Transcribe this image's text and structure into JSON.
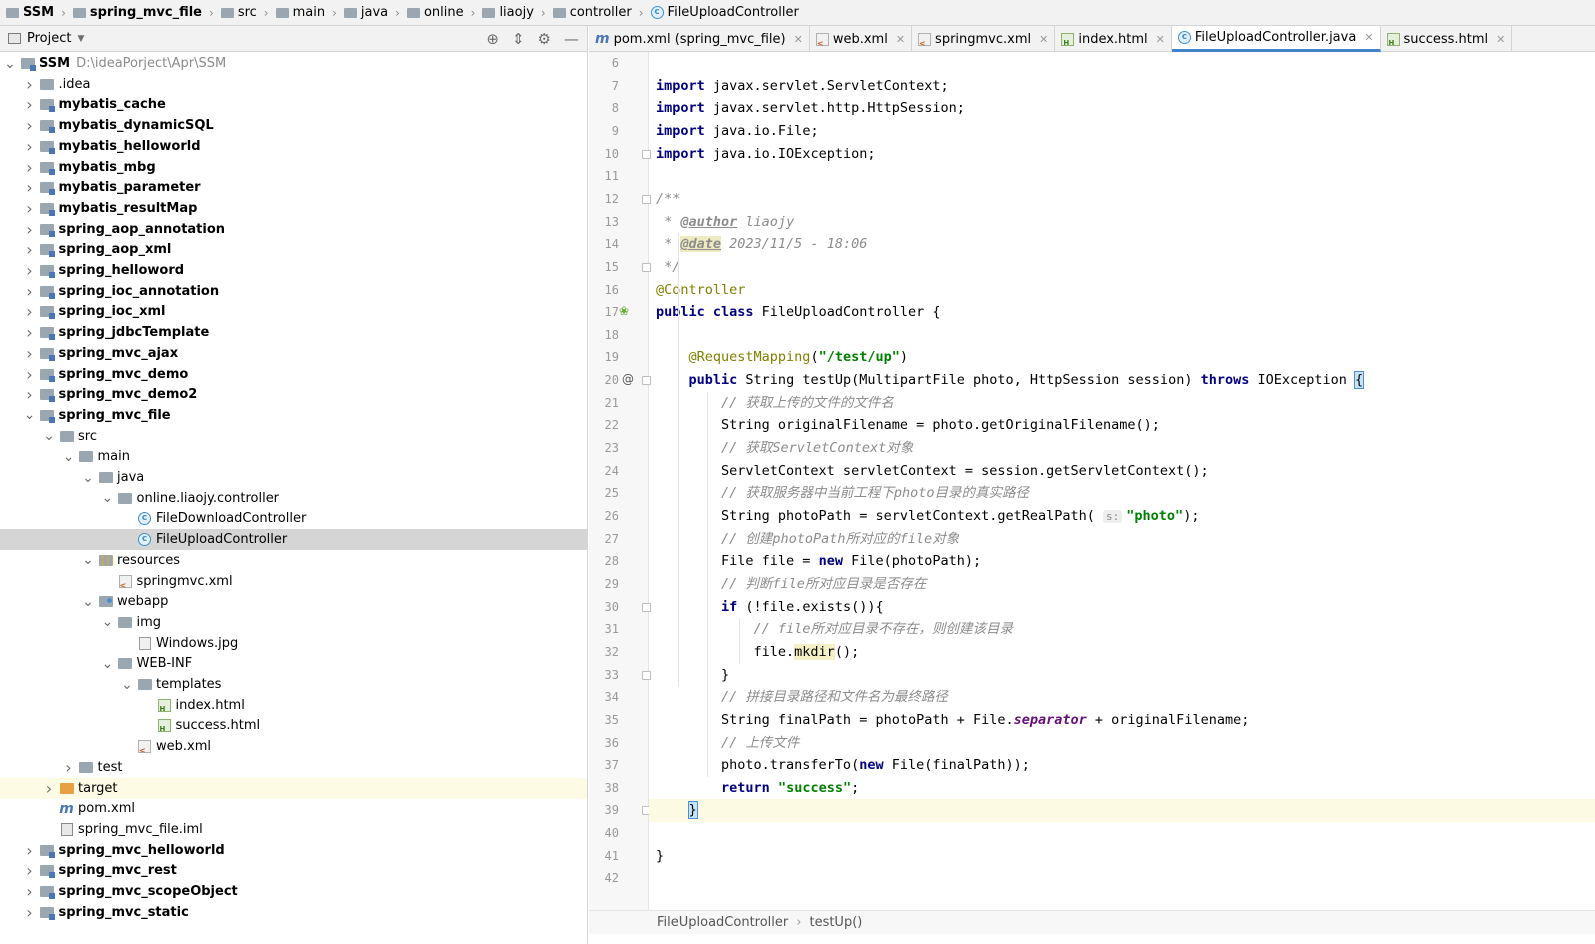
{
  "breadcrumb": {
    "items": [
      {
        "label": "SSM",
        "bold": true
      },
      {
        "label": "spring_mvc_file",
        "bold": true
      },
      {
        "label": "src"
      },
      {
        "label": "main"
      },
      {
        "label": "java"
      },
      {
        "label": "online"
      },
      {
        "label": "liaojy"
      },
      {
        "label": "controller"
      },
      {
        "label": "FileUploadController"
      }
    ]
  },
  "project_panel": {
    "title": "Project",
    "tree": [
      {
        "label": "SSM",
        "path": "D:\\ideaPorject\\Apr\\SSM",
        "depth": 0,
        "expanded": true,
        "icon": "module",
        "bold": true
      },
      {
        "label": ".idea",
        "depth": 1,
        "expanded": false,
        "icon": "folder"
      },
      {
        "label": "mybatis_cache",
        "depth": 1,
        "expanded": false,
        "icon": "module",
        "bold": true
      },
      {
        "label": "mybatis_dynamicSQL",
        "depth": 1,
        "expanded": false,
        "icon": "module",
        "bold": true
      },
      {
        "label": "mybatis_helloworld",
        "depth": 1,
        "expanded": false,
        "icon": "module",
        "bold": true
      },
      {
        "label": "mybatis_mbg",
        "depth": 1,
        "expanded": false,
        "icon": "module",
        "bold": true
      },
      {
        "label": "mybatis_parameter",
        "depth": 1,
        "expanded": false,
        "icon": "module",
        "bold": true
      },
      {
        "label": "mybatis_resultMap",
        "depth": 1,
        "expanded": false,
        "icon": "module",
        "bold": true
      },
      {
        "label": "spring_aop_annotation",
        "depth": 1,
        "expanded": false,
        "icon": "module",
        "bold": true
      },
      {
        "label": "spring_aop_xml",
        "depth": 1,
        "expanded": false,
        "icon": "module",
        "bold": true
      },
      {
        "label": "spring_helloword",
        "depth": 1,
        "expanded": false,
        "icon": "module",
        "bold": true
      },
      {
        "label": "spring_ioc_annotation",
        "depth": 1,
        "expanded": false,
        "icon": "module",
        "bold": true
      },
      {
        "label": "spring_ioc_xml",
        "depth": 1,
        "expanded": false,
        "icon": "module",
        "bold": true
      },
      {
        "label": "spring_jdbcTemplate",
        "depth": 1,
        "expanded": false,
        "icon": "module",
        "bold": true
      },
      {
        "label": "spring_mvc_ajax",
        "depth": 1,
        "expanded": false,
        "icon": "module",
        "bold": true
      },
      {
        "label": "spring_mvc_demo",
        "depth": 1,
        "expanded": false,
        "icon": "module",
        "bold": true
      },
      {
        "label": "spring_mvc_demo2",
        "depth": 1,
        "expanded": false,
        "icon": "module",
        "bold": true
      },
      {
        "label": "spring_mvc_file",
        "depth": 1,
        "expanded": true,
        "icon": "module",
        "bold": true
      },
      {
        "label": "src",
        "depth": 2,
        "expanded": true,
        "icon": "folder"
      },
      {
        "label": "main",
        "depth": 3,
        "expanded": true,
        "icon": "folder"
      },
      {
        "label": "java",
        "depth": 4,
        "expanded": true,
        "icon": "folder-source"
      },
      {
        "label": "online.liaojy.controller",
        "depth": 5,
        "expanded": true,
        "icon": "folder"
      },
      {
        "label": "FileDownloadController",
        "depth": 6,
        "icon": "class"
      },
      {
        "label": "FileUploadController",
        "depth": 6,
        "icon": "class",
        "selected": true
      },
      {
        "label": "resources",
        "depth": 4,
        "expanded": true,
        "icon": "folder-resources"
      },
      {
        "label": "springmvc.xml",
        "depth": 5,
        "icon": "xml"
      },
      {
        "label": "webapp",
        "depth": 4,
        "expanded": true,
        "icon": "folder-web"
      },
      {
        "label": "img",
        "depth": 5,
        "expanded": true,
        "icon": "folder"
      },
      {
        "label": "Windows.jpg",
        "depth": 6,
        "icon": "image"
      },
      {
        "label": "WEB-INF",
        "depth": 5,
        "expanded": true,
        "icon": "folder"
      },
      {
        "label": "templates",
        "depth": 6,
        "expanded": true,
        "icon": "folder"
      },
      {
        "label": "index.html",
        "depth": 7,
        "icon": "html"
      },
      {
        "label": "success.html",
        "depth": 7,
        "icon": "html"
      },
      {
        "label": "web.xml",
        "depth": 6,
        "icon": "xml"
      },
      {
        "label": "test",
        "depth": 3,
        "expanded": false,
        "icon": "folder"
      },
      {
        "label": "target",
        "depth": 2,
        "expanded": false,
        "icon": "folder-excluded",
        "highlighted": true
      },
      {
        "label": "pom.xml",
        "depth": 2,
        "icon": "maven"
      },
      {
        "label": "spring_mvc_file.iml",
        "depth": 2,
        "icon": "iml"
      },
      {
        "label": "spring_mvc_helloworld",
        "depth": 1,
        "expanded": false,
        "icon": "module",
        "bold": true
      },
      {
        "label": "spring_mvc_rest",
        "depth": 1,
        "expanded": false,
        "icon": "module",
        "bold": true
      },
      {
        "label": "spring_mvc_scopeObject",
        "depth": 1,
        "expanded": false,
        "icon": "module",
        "bold": true
      },
      {
        "label": "spring_mvc_static",
        "depth": 1,
        "expanded": false,
        "icon": "module",
        "bold": true
      }
    ]
  },
  "editor_tabs": [
    {
      "label": "pom.xml (spring_mvc_file)",
      "icon": "maven"
    },
    {
      "label": "web.xml",
      "icon": "xml"
    },
    {
      "label": "springmvc.xml",
      "icon": "xml"
    },
    {
      "label": "index.html",
      "icon": "html"
    },
    {
      "label": "FileUploadController.java",
      "icon": "class",
      "active": true
    },
    {
      "label": "success.html",
      "icon": "html"
    }
  ],
  "editor": {
    "current_line": 39,
    "lines": [
      {
        "n": "6",
        "html": ""
      },
      {
        "n": "7",
        "html": "<span class=\"kw\">import</span> javax.servlet.ServletContext;"
      },
      {
        "n": "8",
        "html": "<span class=\"kw\">import</span> javax.servlet.http.HttpSession;"
      },
      {
        "n": "9",
        "html": "<span class=\"kw\">import</span> java.io.File;"
      },
      {
        "n": "10",
        "html": "<span class=\"kw\">import</span> java.io.IOException;"
      },
      {
        "n": "11",
        "html": ""
      },
      {
        "n": "12",
        "html": "<span class=\"cm\">/**</span>"
      },
      {
        "n": "13",
        "html": "<span class=\"cm\"> * </span><span class=\"tag\">@author</span><span class=\"cm\"> liaojy</span>"
      },
      {
        "n": "14",
        "html": "<span class=\"cm\"> * </span><span class=\"tag date\">@date</span><span class=\"cm\"> 2023/11/5 - 18:06</span>"
      },
      {
        "n": "15",
        "html": "<span class=\"cm\"> */</span>"
      },
      {
        "n": "16",
        "html": "<span class=\"ann\">@Controller</span>"
      },
      {
        "n": "17",
        "html": "<span class=\"kw\">public class</span> FileUploadController {"
      },
      {
        "n": "18",
        "html": ""
      },
      {
        "n": "19",
        "html": "    <span class=\"ann\">@RequestMapping</span>(<span class=\"str\">\"/test/up\"</span>)"
      },
      {
        "n": "20",
        "html": "    <span class=\"kw\">public</span> String testUp(MultipartFile photo, HttpSession session) <span class=\"kw\">throws</span> IOException <span class=\"brace-hl\">{</span>"
      },
      {
        "n": "21",
        "html": "        <span class=\"cm\">// 获取上传的文件的文件名</span>"
      },
      {
        "n": "22",
        "html": "        String originalFilename = photo.getOriginalFilename();"
      },
      {
        "n": "23",
        "html": "        <span class=\"cm\">// 获取ServletContext对象</span>"
      },
      {
        "n": "24",
        "html": "        ServletContext servletContext = session.getServletContext();"
      },
      {
        "n": "25",
        "html": "        <span class=\"cm\">// 获取服务器中当前工程下photo目录的真实路径</span>"
      },
      {
        "n": "26",
        "html": "        String photoPath = servletContext.getRealPath( <span class=\"hint\">s:</span><span class=\"str\">\"photo\"</span>);"
      },
      {
        "n": "27",
        "html": "        <span class=\"cm\">// 创建photoPath所对应的file对象</span>"
      },
      {
        "n": "28",
        "html": "        File file = <span class=\"kw\">new</span> File(photoPath);"
      },
      {
        "n": "29",
        "html": "        <span class=\"cm\">// 判断file所对应目录是否存在</span>"
      },
      {
        "n": "30",
        "html": "        <span class=\"kw\">if</span> (!file.exists()){"
      },
      {
        "n": "31",
        "html": "            <span class=\"cm\">// file所对应目录不存在，则创建该目录</span>"
      },
      {
        "n": "32",
        "html": "            file.<span class=\"mk\">mkdir</span>();"
      },
      {
        "n": "33",
        "html": "        }"
      },
      {
        "n": "34",
        "html": "        <span class=\"cm\">// 拼接目录路径和文件名为最终路径</span>"
      },
      {
        "n": "35",
        "html": "        String finalPath = photoPath + File.<span class=\"stat\">separator</span> + originalFilename;"
      },
      {
        "n": "36",
        "html": "        <span class=\"cm\">// 上传文件</span>"
      },
      {
        "n": "37",
        "html": "        photo.transferTo(<span class=\"kw\">new</span> File(finalPath));"
      },
      {
        "n": "38",
        "html": "        <span class=\"kw\">return</span> <span class=\"str\">\"success\"</span>;"
      },
      {
        "n": "39",
        "html": "    <span class=\"brace-hl\">}</span>"
      },
      {
        "n": "40",
        "html": ""
      },
      {
        "n": "41",
        "html": "}"
      },
      {
        "n": "42",
        "html": ""
      }
    ]
  },
  "editor_breadcrumb": {
    "class": "FileUploadController",
    "method": "testUp()"
  },
  "colors": {
    "keyword": "#000080",
    "comment": "#8c8c8c",
    "annotation": "#808000",
    "string": "#008000",
    "selection": "#d5d5d5",
    "current_line": "#fcfae3",
    "active_tab_underline": "#4083c9"
  }
}
